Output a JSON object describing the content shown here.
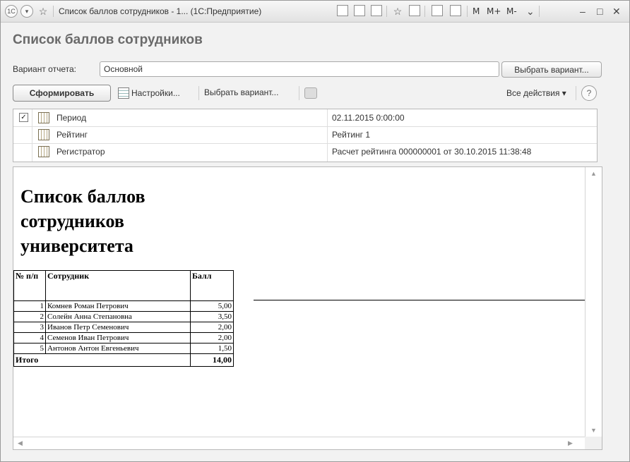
{
  "window": {
    "title": "Список баллов сотрудников - 1... (1С:Предприятие)",
    "app_badge": "1С",
    "mem_buttons": [
      "M",
      "M+",
      "M-"
    ]
  },
  "page": {
    "title": "Список баллов сотрудников"
  },
  "variant": {
    "label": "Вариант отчета:",
    "value": "Основной",
    "choose_button": "Выбрать вариант..."
  },
  "toolbar": {
    "generate": "Сформировать",
    "settings": "Настройки...",
    "choose_variant": "Выбрать вариант...",
    "all_actions": "Все действия ▾",
    "help": "?"
  },
  "params": [
    {
      "checked": true,
      "name": "Период",
      "value": "02.11.2015 0:00:00"
    },
    {
      "checked": false,
      "name": "Рейтинг",
      "value": "Рейтинг 1"
    },
    {
      "checked": false,
      "name": "Регистратор",
      "value": "Расчет рейтинга 000000001 от 30.10.2015 11:38:48"
    }
  ],
  "report": {
    "title_lines": [
      "Список баллов",
      "сотрудников",
      "университета"
    ],
    "columns": {
      "num": "№ п/п",
      "employee": "Сотрудник",
      "score": "Балл"
    },
    "rows": [
      {
        "num": "1",
        "employee": "Комнев Роман Петрович",
        "score": "5,00"
      },
      {
        "num": "2",
        "employee": "Солейн Анна Степановна",
        "score": "3,50"
      },
      {
        "num": "3",
        "employee": "Иванов Петр Семенович",
        "score": "2,00"
      },
      {
        "num": "4",
        "employee": "Семенов Иван Петрович",
        "score": "2,00"
      },
      {
        "num": "5",
        "employee": "Антонов Антон Евгеньевич",
        "score": "1,50"
      }
    ],
    "total": {
      "label": "Итого",
      "score": "14,00"
    }
  }
}
